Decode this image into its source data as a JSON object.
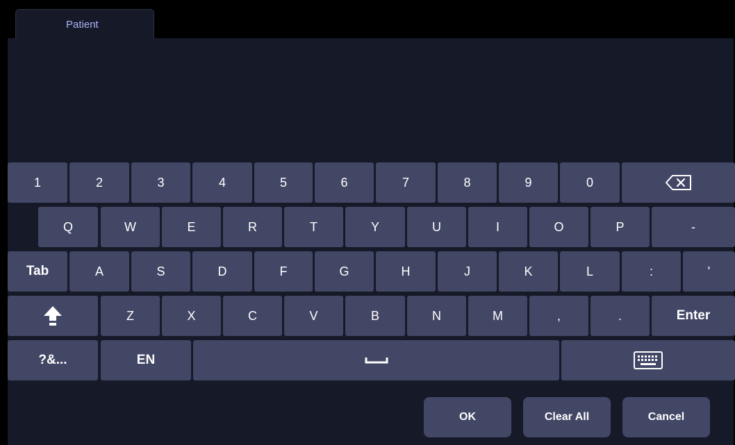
{
  "tab": {
    "label": "Patient"
  },
  "keyboard": {
    "row1": [
      "1",
      "2",
      "3",
      "4",
      "5",
      "6",
      "7",
      "8",
      "9",
      "0"
    ],
    "row2": [
      "Q",
      "W",
      "E",
      "R",
      "T",
      "Y",
      "U",
      "I",
      "O",
      "P",
      "-"
    ],
    "row3": [
      "Tab",
      "A",
      "S",
      "D",
      "F",
      "G",
      "H",
      "J",
      "K",
      "L",
      ":",
      "'"
    ],
    "row4": [
      "Z",
      "X",
      "C",
      "V",
      "B",
      "N",
      "M",
      ",",
      ".",
      "Enter"
    ],
    "row5": {
      "symbols": "?&...",
      "language": "EN"
    },
    "icons": {
      "backspace": "backspace-icon",
      "shift": "shift-arrow-icon",
      "space": "spacebar-icon",
      "hide": "keyboard-icon"
    }
  },
  "actions": {
    "ok": "OK",
    "clear_all": "Clear All",
    "cancel": "Cancel"
  },
  "colors": {
    "key": "#434766",
    "panel": "#161a28",
    "tab_text": "#a9b3f4"
  }
}
